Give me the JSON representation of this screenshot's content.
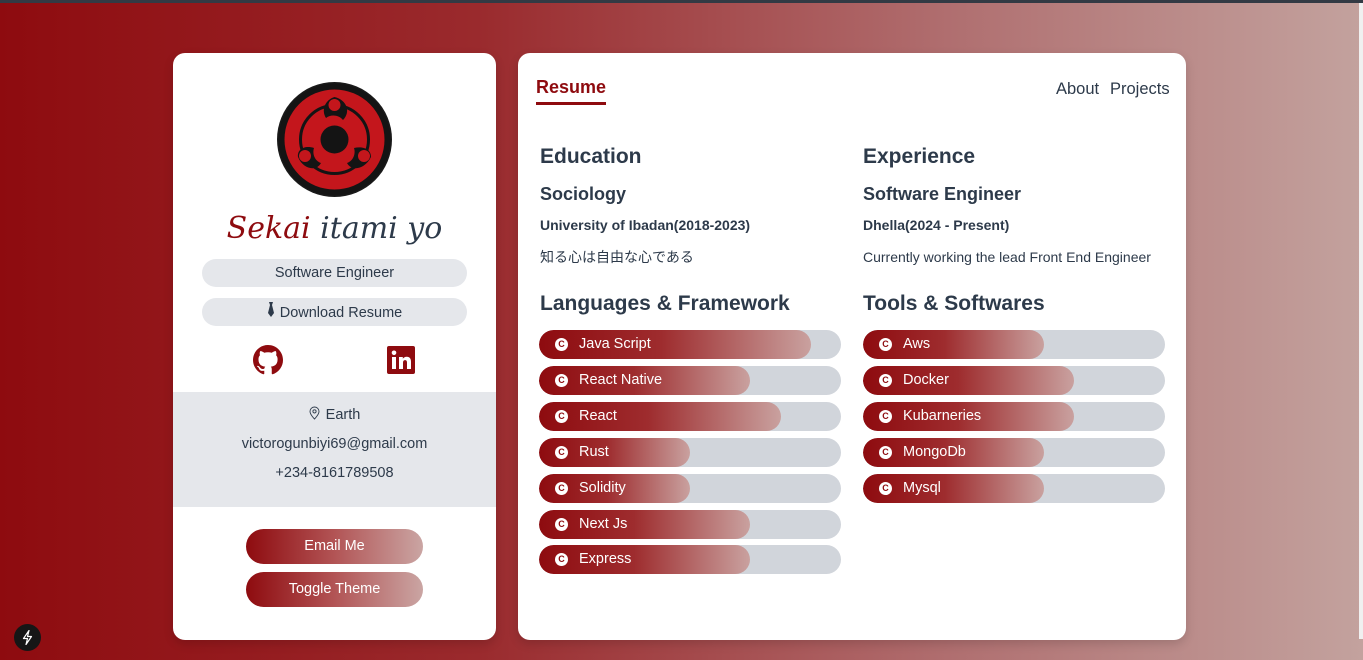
{
  "profile": {
    "name_first": "Sekai",
    "name_rest": " itami yo",
    "role": "Software Engineer",
    "download_label": "Download Resume",
    "location": "Earth",
    "email": "victorogunbiyi69@gmail.com",
    "phone": "+234-8161789508",
    "email_button": "Email Me",
    "theme_button": "Toggle Theme",
    "icons": [
      "sharingan-icon",
      "tie-icon",
      "github-icon",
      "linkedin-icon",
      "map-pin-icon"
    ]
  },
  "nav": {
    "active_tab": "Resume",
    "links": [
      "About",
      "Projects"
    ]
  },
  "education": {
    "title": "Education",
    "degree": "Sociology",
    "institution": "University of Ibadan(2018-2023)",
    "note": "知る心は自由な心である"
  },
  "experience": {
    "title": "Experience",
    "position": "Software Engineer",
    "company": "Dhella(2024 - Present)",
    "note": "Currently working the lead Front End Engineer"
  },
  "languages": {
    "title": "Languages & Framework",
    "items": [
      {
        "label": "Java Script",
        "level": 0.9
      },
      {
        "label": "React Native",
        "level": 0.7
      },
      {
        "label": "React",
        "level": 0.8
      },
      {
        "label": "Rust",
        "level": 0.5
      },
      {
        "label": "Solidity",
        "level": 0.5
      },
      {
        "label": "Next Js",
        "level": 0.7
      },
      {
        "label": "Express",
        "level": 0.7
      }
    ]
  },
  "tools": {
    "title": "Tools & Softwares",
    "items": [
      {
        "label": "Aws",
        "level": 0.6
      },
      {
        "label": "Docker",
        "level": 0.7
      },
      {
        "label": "Kubarneries",
        "level": 0.7
      },
      {
        "label": "MongoDb",
        "level": 0.6
      },
      {
        "label": "Mysql",
        "level": 0.6
      }
    ]
  },
  "colors": {
    "accent": "#8e0b0f",
    "text": "#2d3a4a",
    "pill_bg": "#e5e7eb",
    "track_bg": "#d1d5db"
  }
}
